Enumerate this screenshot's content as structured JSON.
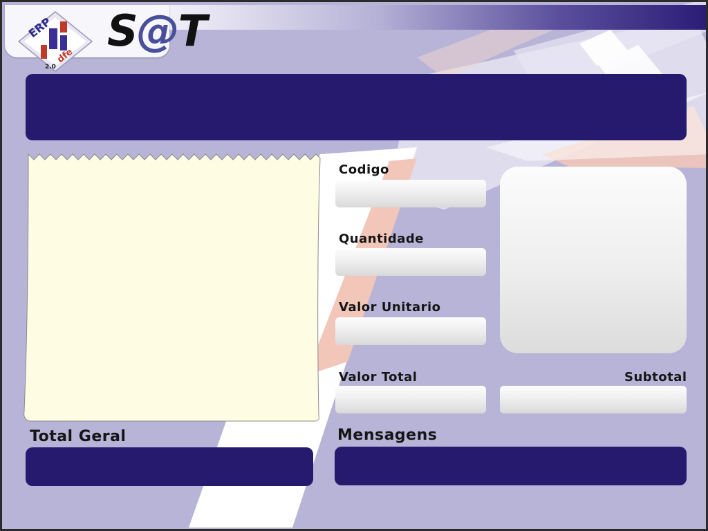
{
  "app": {
    "logo_text_s": "S",
    "logo_text_at": "@",
    "logo_text_t": "T"
  },
  "labels": {
    "codigo": "Codigo",
    "quantidade": "Quantidade",
    "valor_unitario": "Valor Unitario",
    "valor_total": "Valor Total",
    "subtotal": "Subtotal",
    "total_geral": "Total Geral",
    "mensagens": "Mensagens"
  },
  "fields": {
    "codigo": "",
    "quantidade": "",
    "valor_unitario": "",
    "valor_total": "",
    "subtotal": "",
    "total_geral": "",
    "mensagens": "",
    "header_display": ""
  },
  "colors": {
    "navy": "#261a6f",
    "background": "#b8b4d8",
    "receipt": "#fefce2",
    "accent_salmon": "#f2c7b9"
  }
}
